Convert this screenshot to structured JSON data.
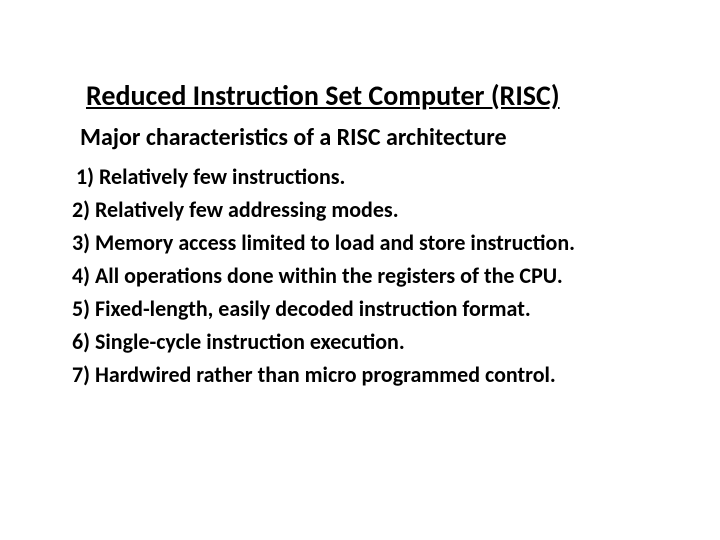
{
  "title": "Reduced Instruction Set Computer (RISC)",
  "subtitle": "Major characteristics of a RISC architecture",
  "items": [
    " 1) Relatively few instructions.",
    "2) Relatively few addressing modes.",
    "3) Memory access limited to load and store instruction.",
    "4) All operations done within the registers of the CPU.",
    "5) Fixed-length, easily decoded instruction format.",
    "6) Single-cycle instruction execution.",
    "7) Hardwired rather than micro programmed control."
  ]
}
